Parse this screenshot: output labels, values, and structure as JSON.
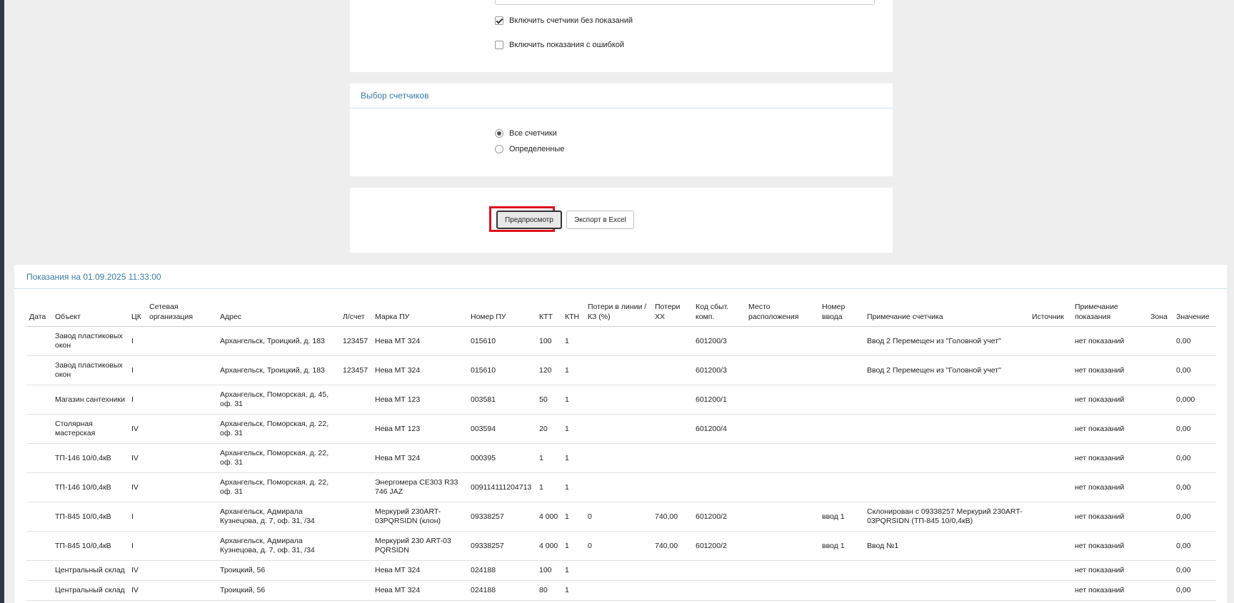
{
  "options": {
    "include_no_readings": "Включить счетчики без показаний",
    "include_errors": "Включить показания с ошибкой"
  },
  "meters": {
    "title": "Выбор счетчиков",
    "all": "Все счетчики",
    "specific": "Определенные"
  },
  "actions": {
    "preview": "Предпросмотр",
    "export": "Экспорт в Excel"
  },
  "results": {
    "title": "Показания на 01.09.2025 11:33:00",
    "columns": [
      "Дата",
      "Объект",
      "ЦК",
      "Сетевая организация",
      "Адрес",
      "Л/счет",
      "Марка ПУ",
      "Номер ПУ",
      "КТТ",
      "КТН",
      "Потери в линии / КЗ (%)",
      "Потери ХХ",
      "Код сбыт. комп.",
      "Место расположения",
      "Номер ввода",
      "Примечание счетчика",
      "Источник",
      "Примечание показания",
      "Зона",
      "Значение"
    ],
    "rows": [
      [
        "",
        "Завод пластиковых окон",
        "I",
        "",
        "Архангельск, Троицкий, д. 183",
        "123457",
        "Нева МТ 324",
        "015610",
        "100",
        "1",
        "",
        "",
        "601200/3",
        "",
        "",
        "Ввод 2 Перемещен из \"Головной учет\"",
        "",
        "нет показаний",
        "",
        "0,00"
      ],
      [
        "",
        "Завод пластиковых окон",
        "I",
        "",
        "Архангельск, Троицкий, д. 183",
        "123457",
        "Нева МТ 324",
        "015610",
        "120",
        "1",
        "",
        "",
        "601200/3",
        "",
        "",
        "Ввод 2 Перемещен из \"Головной учет\"",
        "",
        "нет показаний",
        "",
        "0,00"
      ],
      [
        "",
        "Магазин сантехники",
        "I",
        "",
        "Архангельск, Поморская, д. 45, оф. 31",
        "",
        "Нева МТ 123",
        "003581",
        "50",
        "1",
        "",
        "",
        "601200/1",
        "",
        "",
        "",
        "",
        "нет показаний",
        "",
        "0,000"
      ],
      [
        "",
        "Столярная мастерская",
        "IV",
        "",
        "Архангельск, Поморская, д. 22, оф. 31",
        "",
        "Нева МТ 123",
        "003594",
        "20",
        "1",
        "",
        "",
        "601200/4",
        "",
        "",
        "",
        "",
        "нет показаний",
        "",
        "0,00"
      ],
      [
        "",
        "ТП-146 10/0,4кВ",
        "IV",
        "",
        "Архангельск, Поморская, д. 22, оф. 31",
        "",
        "Нева МТ 324",
        "000395",
        "1",
        "1",
        "",
        "",
        "",
        "",
        "",
        "",
        "",
        "нет показаний",
        "",
        "0,00"
      ],
      [
        "",
        "ТП-146 10/0,4кВ",
        "IV",
        "",
        "Архангельск, Поморская, д. 22, оф. 31",
        "",
        "Энергомера СЕ303 R33 746 JAZ",
        "009114111204713",
        "1",
        "1",
        "",
        "",
        "",
        "",
        "",
        "",
        "",
        "нет показаний",
        "",
        "0,00"
      ],
      [
        "",
        "ТП-845 10/0,4кВ",
        "I",
        "",
        "Архангельск, Адмирала Кузнецова, д. 7, оф. 31, /34",
        "",
        "Меркурий 230ART-03PQRSIDN (клон)",
        "09338257",
        "4 000",
        "1",
        "0",
        "740,00",
        "601200/2",
        "",
        "ввод 1",
        "Склонирован с 09338257 Меркурий 230ART-03PQRSIDN (ТП-845 10/0,4кВ)",
        "",
        "нет показаний",
        "",
        "0,00"
      ],
      [
        "",
        "ТП-845 10/0,4кВ",
        "I",
        "",
        "Архангельск, Адмирала Кузнецова, д. 7, оф. 31, /34",
        "",
        "Меркурий 230 ART-03 PQRSIDN",
        "09338257",
        "4 000",
        "1",
        "0",
        "740,00",
        "601200/2",
        "",
        "ввод 1",
        "Ввод №1",
        "",
        "нет показаний",
        "",
        "0,00"
      ],
      [
        "",
        "Центральный склад",
        "IV",
        "",
        "Троицкий, 56",
        "",
        "Нева МТ 324",
        "024188",
        "100",
        "1",
        "",
        "",
        "",
        "",
        "",
        "",
        "",
        "нет показаний",
        "",
        "0,00"
      ],
      [
        "",
        "Центральный склад",
        "IV",
        "",
        "Троицкий, 56",
        "",
        "Нева МТ 324",
        "024188",
        "80",
        "1",
        "",
        "",
        "",
        "",
        "",
        "",
        "",
        "нет показаний",
        "",
        "0,00"
      ]
    ]
  }
}
